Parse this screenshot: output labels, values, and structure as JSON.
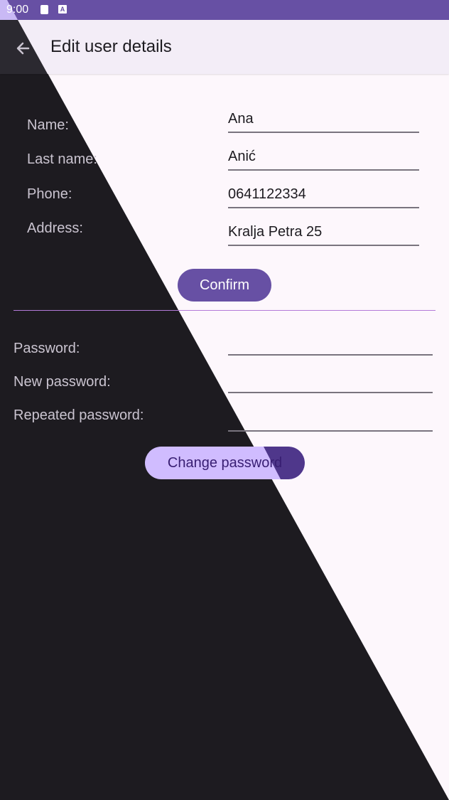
{
  "status_bar": {
    "time": "9:00",
    "icons": [
      "document-icon",
      "a-icon"
    ],
    "a_icon_text": "A"
  },
  "appbar": {
    "back_icon": "arrow-back-icon",
    "title": "Edit user details"
  },
  "profile_form": {
    "fields": [
      {
        "label": "Name:",
        "value": "Ana"
      },
      {
        "label": "Last name:",
        "value": "Anić"
      },
      {
        "label": "Phone:",
        "value": "0641122334"
      },
      {
        "label": "Address:",
        "value": "Kralja Petra 25"
      }
    ],
    "confirm_label": "Confirm"
  },
  "password_form": {
    "fields": [
      {
        "label": "Password:",
        "value": ""
      },
      {
        "label": "New password:",
        "value": ""
      },
      {
        "label": "Repeated password:",
        "value": ""
      }
    ],
    "change_label": "Change password"
  },
  "colors": {
    "primary": "#6750a4",
    "dark_surface": "#1d1b20",
    "light_surface": "#fdf7fc",
    "primary_container": "#d0bcff",
    "divider": "#b37ad8"
  }
}
